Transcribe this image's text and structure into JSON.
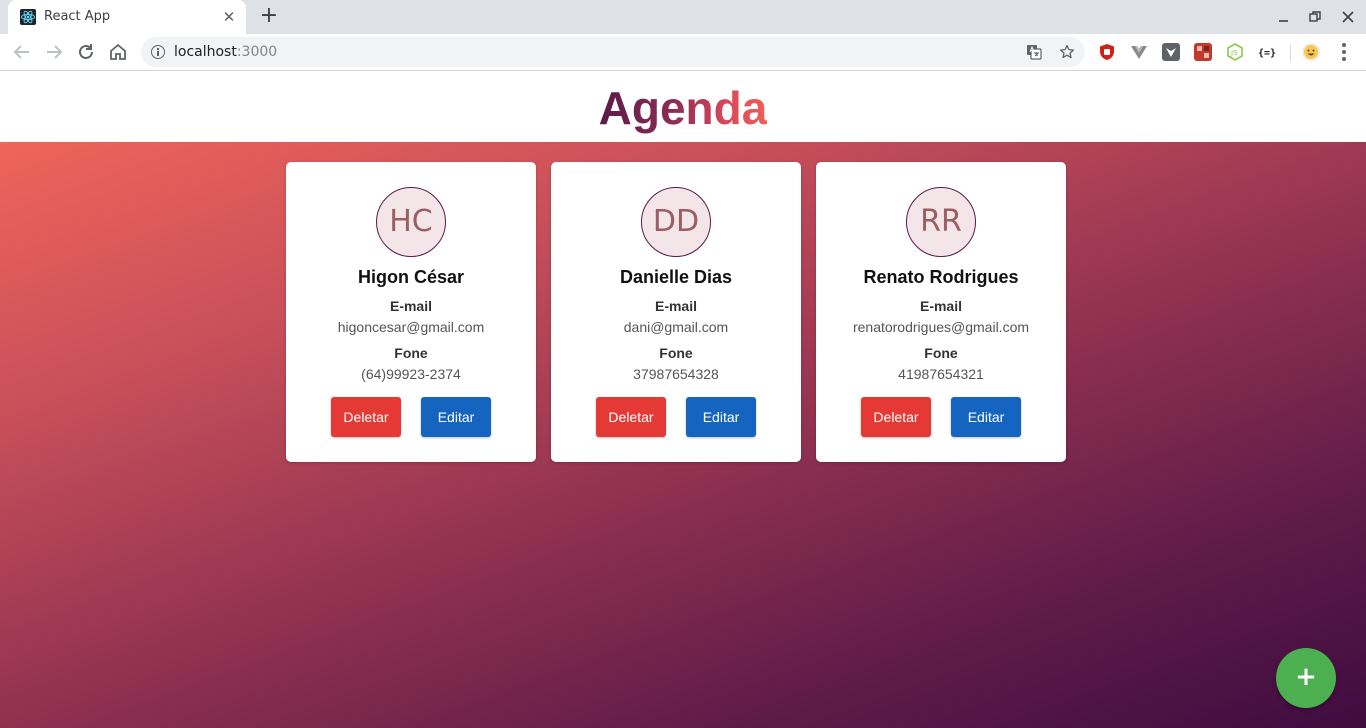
{
  "browser": {
    "tab_title": "React App",
    "url_host": "localhost",
    "url_port": ":3000",
    "tab_close_glyph": "✕",
    "new_tab_glyph": "+"
  },
  "app": {
    "title": "Agenda",
    "add_button_glyph": "+"
  },
  "labels": {
    "email": "E-mail",
    "phone": "Fone",
    "delete": "Deletar",
    "edit": "Editar"
  },
  "contacts": [
    {
      "initials": "HC",
      "name": "Higon César",
      "email": "higoncesar@gmail.com",
      "phone": "(64)99923-2374"
    },
    {
      "initials": "DD",
      "name": "Danielle Dias",
      "email": "dani@gmail.com",
      "phone": "37987654328"
    },
    {
      "initials": "RR",
      "name": "Renato Rodrigues",
      "email": "renatorodrigues@gmail.com",
      "phone": "41987654321"
    }
  ],
  "colors": {
    "delete_button": "#e53935",
    "edit_button": "#1565c0",
    "fab": "#4caf50",
    "gradient_start": "#f0645a",
    "gradient_end": "#3f0c40"
  },
  "icons": {
    "nav": [
      "back-icon",
      "forward-icon",
      "reload-icon",
      "home-icon"
    ],
    "omnibox": [
      "info-icon",
      "translate-icon",
      "star-icon"
    ],
    "extensions": [
      "ublock-icon",
      "vue-devtools-icon",
      "lion-extension-icon",
      "pixel-extension-icon",
      "node-extension-icon",
      "json-extension-icon",
      "profile-avatar-icon"
    ]
  }
}
